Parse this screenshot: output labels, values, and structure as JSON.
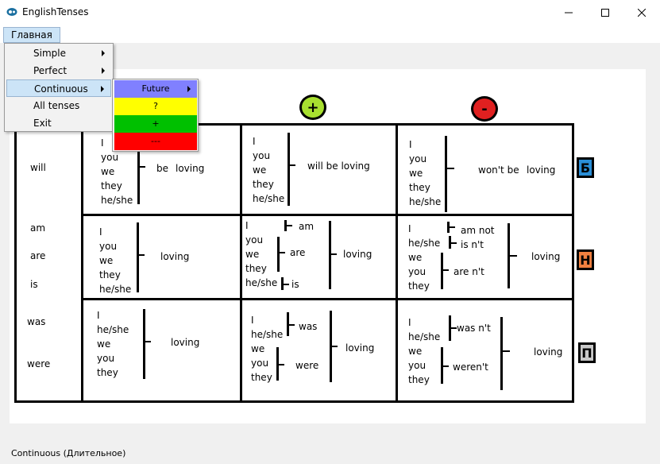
{
  "window": {
    "title": "EnglishTenses"
  },
  "menubar": {
    "main_label": "Главная"
  },
  "dropdown": {
    "items": [
      {
        "label": "Simple",
        "submenu": true
      },
      {
        "label": "Perfect",
        "submenu": true
      },
      {
        "label": "Continuous",
        "submenu": true
      },
      {
        "label": "All tenses",
        "submenu": false
      },
      {
        "label": "Exit",
        "submenu": false
      }
    ]
  },
  "submenu": {
    "items": [
      {
        "label": "Future",
        "color": "#8080ff"
      },
      {
        "label": "?",
        "color": "#ffff00"
      },
      {
        "label": "+",
        "color": "#00c000"
      },
      {
        "label": "---",
        "color": "#ff0000"
      }
    ]
  },
  "headers": {
    "plus": {
      "label": "+",
      "color": "#a8e030"
    },
    "minus": {
      "label": "-",
      "color": "#e02020"
    }
  },
  "tags": {
    "b": {
      "label": "Б",
      "color": "#2a8fd8"
    },
    "n": {
      "label": "Н",
      "color": "#f08040"
    },
    "p": {
      "label": "П",
      "color": "#c8c8c8"
    }
  },
  "aux": {
    "will": "will",
    "am": "am",
    "are": "are",
    "is": "is",
    "was": "was",
    "were": "were"
  },
  "future": {
    "q": {
      "pronouns": [
        "I",
        "you",
        "we",
        "they",
        "he/she"
      ],
      "aux": "be",
      "verb": "loving"
    },
    "plus": {
      "pronouns": [
        "I",
        "you",
        "we",
        "they",
        "he/she"
      ],
      "phrase": "will be loving"
    },
    "minus": {
      "pronouns": [
        "I",
        "you",
        "we",
        "they",
        "he/she"
      ],
      "phrase": "won't be",
      "verb": "loving"
    }
  },
  "present": {
    "q": {
      "pronouns": [
        "I",
        "you",
        "we",
        "they",
        "he/she"
      ],
      "verb": "loving"
    },
    "plus": {
      "pronouns": [
        "I",
        "you",
        "we",
        "they",
        "he/she"
      ],
      "aux_am": "am",
      "aux_are": "are",
      "aux_is": "is",
      "verb": "loving"
    },
    "minus": {
      "pronouns": [
        "I",
        "he/she",
        "we",
        "you",
        "they"
      ],
      "aux_am": "am not",
      "aux_is": "is n't",
      "aux_are": "are n't",
      "verb": "loving"
    }
  },
  "past": {
    "q": {
      "pronouns": [
        "I",
        "he/she",
        "we",
        "you",
        "they"
      ],
      "verb": "loving"
    },
    "plus": {
      "pronouns": [
        "I",
        "he/she",
        "we",
        "you",
        "they"
      ],
      "aux_was": "was",
      "aux_were": "were",
      "verb": "loving"
    },
    "minus": {
      "pronouns": [
        "I",
        "he/she",
        "we",
        "you",
        "they"
      ],
      "aux_was": "was n't",
      "aux_were": "weren't",
      "verb": "loving"
    }
  },
  "status": {
    "text": "Continuous (Длительное)"
  }
}
